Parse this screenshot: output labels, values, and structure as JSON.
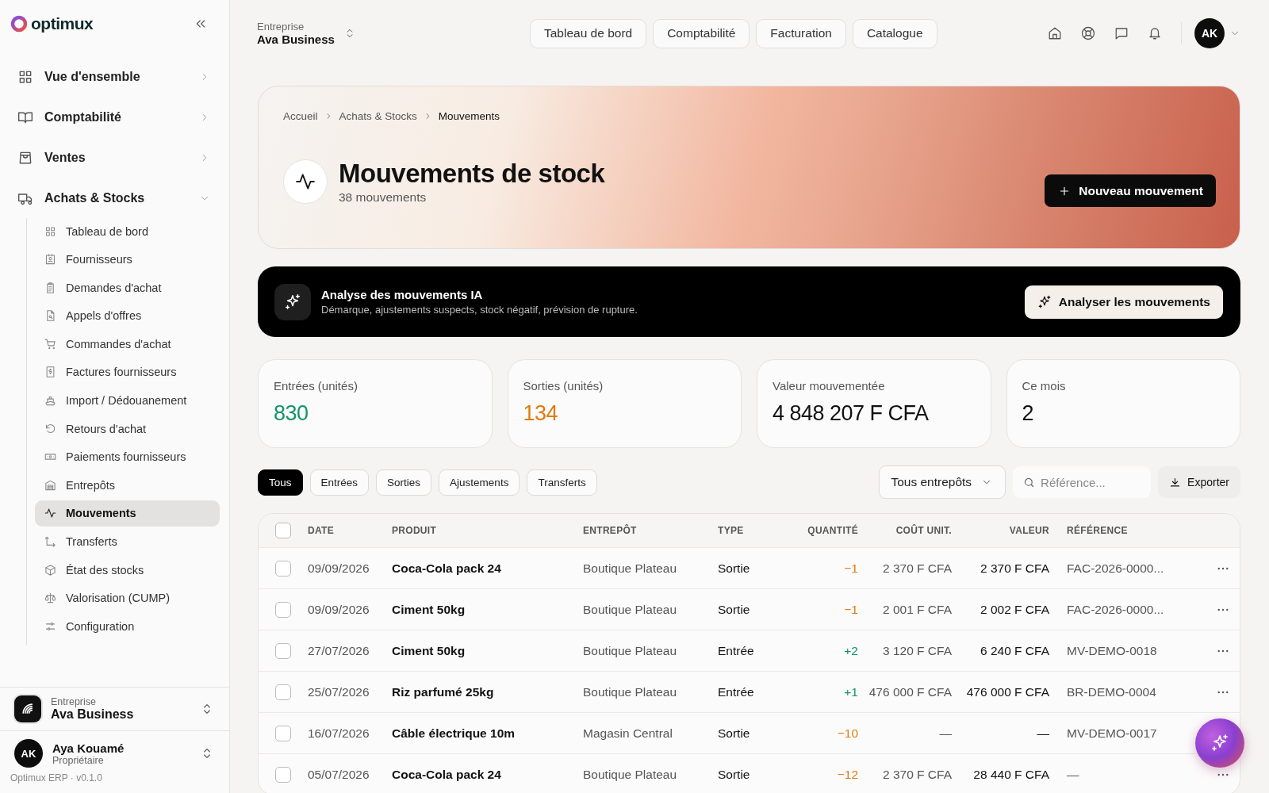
{
  "sidebar": {
    "logo": "optimux",
    "items": [
      {
        "label": "Vue d'ensemble",
        "expanded": false
      },
      {
        "label": "Comptabilité",
        "expanded": false
      },
      {
        "label": "Ventes",
        "expanded": false
      },
      {
        "label": "Achats & Stocks",
        "expanded": true,
        "children": [
          {
            "label": "Tableau de bord",
            "selected": false
          },
          {
            "label": "Fournisseurs",
            "selected": false
          },
          {
            "label": "Demandes d'achat",
            "selected": false
          },
          {
            "label": "Appels d'offres",
            "selected": false
          },
          {
            "label": "Commandes d'achat",
            "selected": false
          },
          {
            "label": "Factures fournisseurs",
            "selected": false
          },
          {
            "label": "Import / Dédouanement",
            "selected": false
          },
          {
            "label": "Retours d'achat",
            "selected": false
          },
          {
            "label": "Paiements fournisseurs",
            "selected": false
          },
          {
            "label": "Entrepôts",
            "selected": false
          },
          {
            "label": "Mouvements",
            "selected": true
          },
          {
            "label": "Transferts",
            "selected": false
          },
          {
            "label": "État des stocks",
            "selected": false
          },
          {
            "label": "Valorisation (CUMP)",
            "selected": false
          },
          {
            "label": "Configuration",
            "selected": false
          }
        ]
      }
    ],
    "company": {
      "caption": "Entreprise",
      "name": "Ava Business"
    },
    "user": {
      "initials": "AK",
      "name": "Aya Kouamé",
      "role": "Propriétaire"
    },
    "version": "Optimux ERP · v0.1.0"
  },
  "topbar": {
    "company": {
      "caption": "Entreprise",
      "name": "Ava Business"
    },
    "nav": [
      "Tableau de bord",
      "Comptabilité",
      "Facturation",
      "Catalogue"
    ],
    "avatar": "AK"
  },
  "header": {
    "breadcrumb": [
      "Accueil",
      "Achats & Stocks",
      "Mouvements"
    ],
    "title": "Mouvements de stock",
    "subtitle": "38 mouvements",
    "action": "Nouveau mouvement"
  },
  "ai_banner": {
    "title": "Analyse des mouvements IA",
    "description": "Démarque, ajustements suspects, stock négatif, prévision de rupture.",
    "action": "Analyser les mouvements"
  },
  "stats": [
    {
      "label": "Entrées (unités)",
      "value": "830",
      "color": "#129469"
    },
    {
      "label": "Sorties (unités)",
      "value": "134",
      "color": "#df7a0e"
    },
    {
      "label": "Valeur mouvementée",
      "value": "4 848 207 F CFA",
      "color": "#111111"
    },
    {
      "label": "Ce mois",
      "value": "2",
      "color": "#111111"
    }
  ],
  "filters": [
    {
      "label": "Tous",
      "selected": true
    },
    {
      "label": "Entrées",
      "selected": false
    },
    {
      "label": "Sorties",
      "selected": false
    },
    {
      "label": "Ajustements",
      "selected": false
    },
    {
      "label": "Transferts",
      "selected": false
    }
  ],
  "warehouse_select": "Tous entrepôts",
  "search": {
    "placeholder": "Référence..."
  },
  "export": "Exporter",
  "table": {
    "select_all_checked": false,
    "columns": [
      "DATE",
      "PRODUIT",
      "ENTREPÔT",
      "TYPE",
      "QUANTITÉ",
      "COÛT UNIT.",
      "VALEUR",
      "RÉFÉRENCE"
    ],
    "rows": [
      {
        "checked": false,
        "kind": "out",
        "date": "09/09/2026",
        "product": "Coca-Cola pack 24",
        "warehouse": "Boutique Plateau",
        "type": "Sortie",
        "quantity": "−1",
        "unit_cost": "2 370 F CFA",
        "value": "2 370 F CFA",
        "reference": "FAC-2026-0000..."
      },
      {
        "checked": false,
        "kind": "out",
        "date": "09/09/2026",
        "product": "Ciment 50kg",
        "warehouse": "Boutique Plateau",
        "type": "Sortie",
        "quantity": "−1",
        "unit_cost": "2 001 F CFA",
        "value": "2 002 F CFA",
        "reference": "FAC-2026-0000..."
      },
      {
        "checked": false,
        "kind": "in",
        "date": "27/07/2026",
        "product": "Ciment 50kg",
        "warehouse": "Boutique Plateau",
        "type": "Entrée",
        "quantity": "+2",
        "unit_cost": "3 120 F CFA",
        "value": "6 240 F CFA",
        "reference": "MV-DEMO-0018"
      },
      {
        "checked": false,
        "kind": "in",
        "date": "25/07/2026",
        "product": "Riz parfumé 25kg",
        "warehouse": "Boutique Plateau",
        "type": "Entrée",
        "quantity": "+1",
        "unit_cost": "476 000 F CFA",
        "value": "476 000 F CFA",
        "reference": "BR-DEMO-0004"
      },
      {
        "checked": false,
        "kind": "out",
        "date": "16/07/2026",
        "product": "Câble électrique 10m",
        "warehouse": "Magasin Central",
        "type": "Sortie",
        "quantity": "−10",
        "unit_cost": "—",
        "value": "—",
        "reference": "MV-DEMO-0017"
      },
      {
        "checked": false,
        "kind": "out",
        "date": "05/07/2026",
        "product": "Coca-Cola pack 24",
        "warehouse": "Boutique Plateau",
        "type": "Sortie",
        "quantity": "−12",
        "unit_cost": "2 370 F CFA",
        "value": "28 440 F CFA",
        "reference": "—"
      }
    ]
  }
}
